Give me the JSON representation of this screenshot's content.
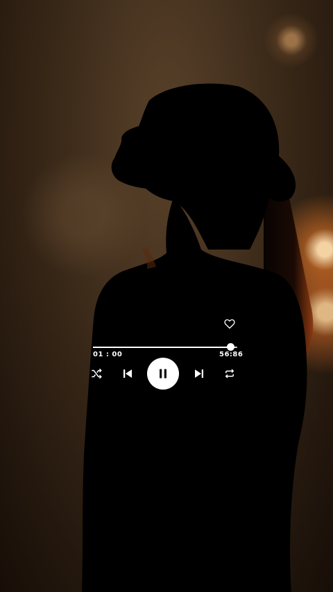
{
  "player": {
    "elapsed": "01 : 00",
    "total": "56:86",
    "progress": 0.95,
    "liked": false,
    "state": "playing"
  },
  "icons": {
    "like": "heart-outline-icon",
    "shuffle": "shuffle-icon",
    "previous": "skip-previous-icon",
    "play_pause": "pause-icon",
    "next": "skip-next-icon",
    "repeat": "repeat-icon"
  },
  "colors": {
    "controls": "#ffffff",
    "play_button_icon": "#111111"
  }
}
